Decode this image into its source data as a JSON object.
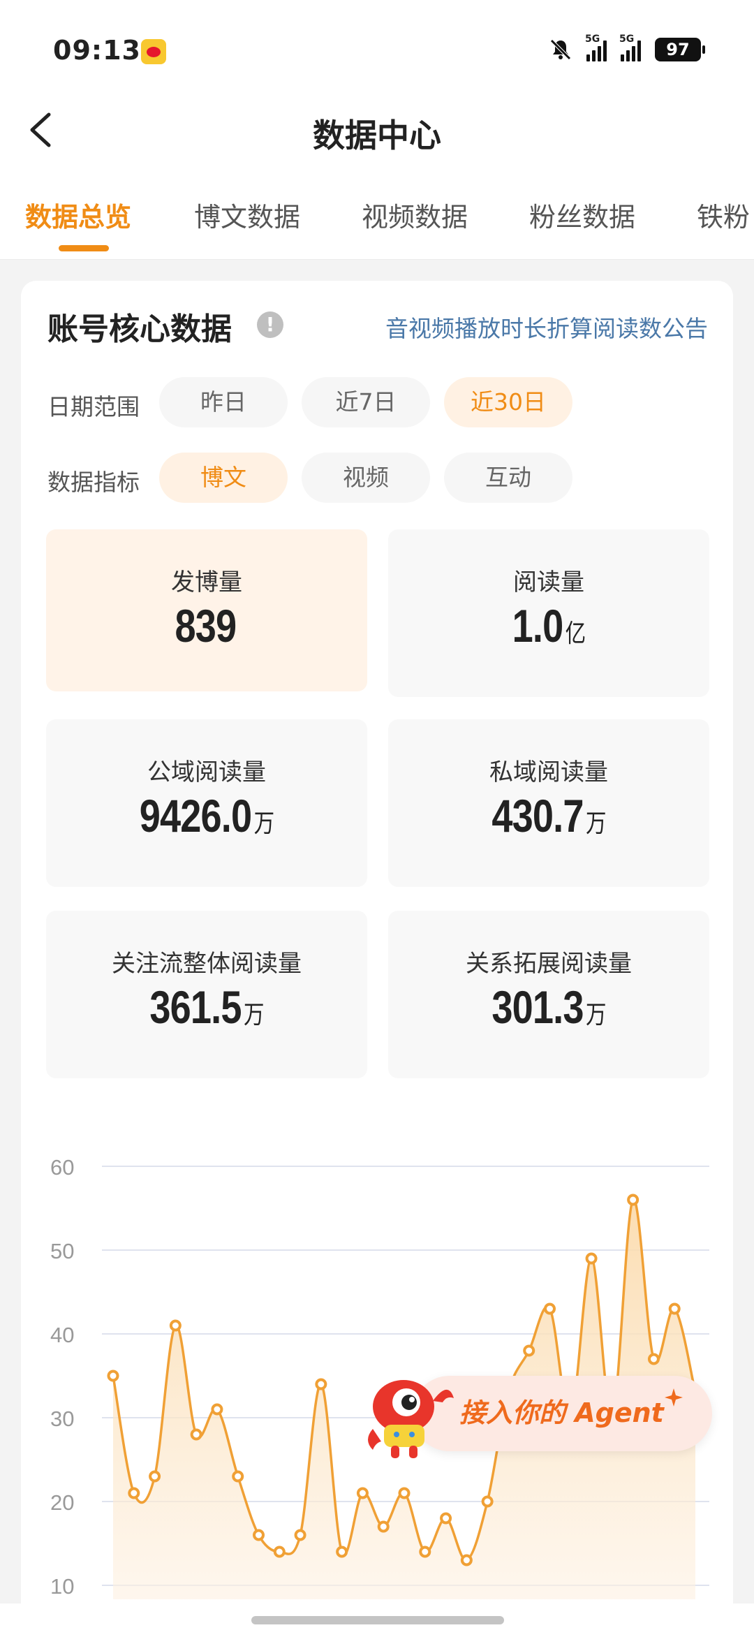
{
  "status_bar": {
    "time": "09:13",
    "signal1": "5G",
    "signal2": "5G",
    "battery": "97"
  },
  "nav": {
    "title": "数据中心"
  },
  "tabs": [
    "数据总览",
    "博文数据",
    "视频数据",
    "粉丝数据",
    "铁粉"
  ],
  "active_tab": 0,
  "card": {
    "title": "账号核心数据",
    "notice": "音视频播放时长折算阅读数公告",
    "date_label": "日期范围",
    "date_options": [
      "昨日",
      "近7日",
      "近30日"
    ],
    "date_selected": "近30日",
    "metric_label": "数据指标",
    "metric_options": [
      "博文",
      "视频",
      "互动"
    ],
    "metric_selected": "博文"
  },
  "stats": [
    {
      "label": "发博量",
      "value": "839",
      "unit": ""
    },
    {
      "label": "阅读量",
      "value": "1.0",
      "unit": "亿"
    },
    {
      "label": "公域阅读量",
      "value": "9426.0",
      "unit": "万"
    },
    {
      "label": "私域阅读量",
      "value": "430.7",
      "unit": "万"
    },
    {
      "label": "关注流整体阅读量",
      "value": "361.5",
      "unit": "万"
    },
    {
      "label": "关系拓展阅读量",
      "value": "301.3",
      "unit": "万"
    }
  ],
  "agent_banner": {
    "text": "接入你的 Agent"
  },
  "colors": {
    "accent": "#f08c15",
    "link": "#4a78a8",
    "line": "#f0a035"
  },
  "chart_data": {
    "type": "area",
    "y_ticks": [
      60,
      50,
      40,
      30,
      20,
      10
    ],
    "ylim": [
      10,
      60
    ],
    "grid": true,
    "series": [
      {
        "values": [
          35,
          21,
          23,
          41,
          28,
          31,
          23,
          16,
          14,
          16,
          34,
          14,
          21,
          17,
          21,
          14,
          18,
          13,
          20,
          33,
          38,
          43,
          30,
          49,
          30,
          56,
          37,
          43,
          33
        ]
      }
    ]
  }
}
